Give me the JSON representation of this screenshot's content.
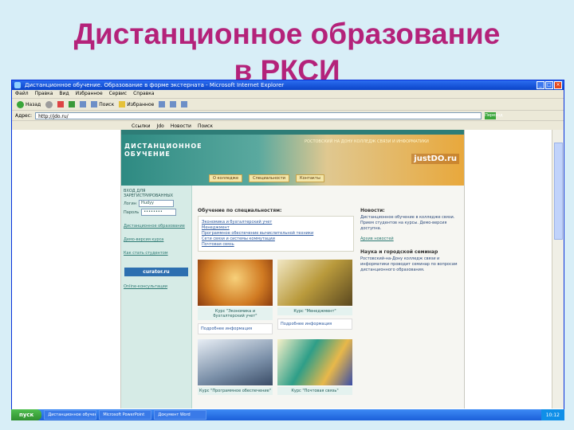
{
  "slide": {
    "title_line1": "Дистанционное образование",
    "title_line2": "в РКСИ"
  },
  "browser": {
    "window_title": "Дистанционное обучение. Образование в форме экстерната - Microsoft Internet Explorer",
    "menu": [
      "Файл",
      "Правка",
      "Вид",
      "Избранное",
      "Сервис",
      "Справка"
    ],
    "toolbar": {
      "back": "Назад",
      "search": "Поиск",
      "favorites": "Избранное"
    },
    "address_label": "Адрес:",
    "address_value": "http://jdo.ru/",
    "go_label": "Переход",
    "links": [
      "Ссылки",
      "Jdo",
      "Новости",
      "Поиск"
    ]
  },
  "site": {
    "logo": "ДИСТАНЦИОННОЕ ОБУЧЕНИЕ",
    "tagline": "РОСТОВСКИЙ НА ДОНУ КОЛЛЕДЖ СВЯЗИ И ИНФОРМАТИКИ",
    "brand": "justDO.ru",
    "nav": [
      "О колледже",
      "Специальности",
      "Контакты"
    ],
    "login": {
      "label": "ВХОД ДЛЯ ЗАРЕГИСТРИРОВАННЫХ",
      "login_label": "Логин",
      "login_value": "Hudyy",
      "password_label": "Пароль",
      "password_value": "••••••••"
    },
    "side_links": [
      "Дистанционное образование",
      "Демо-версия курса",
      "Как стать студентом"
    ],
    "badge": "curator.ru",
    "side_bottom": "Online-консультации",
    "section_title": "Обучение по специальностям:",
    "specialties": [
      "Экономика и бухгалтерский учет",
      "Менеджмент",
      "Программное обеспечение вычислительной техники",
      "Сети связи и системы коммутации",
      "Почтовая связь"
    ],
    "captions": [
      "Курс \"Экономика и бухгалтерский учет\"",
      "Курс \"Менеджмент\""
    ],
    "blocks": [
      "Подробнее информация",
      "Подробнее информация"
    ],
    "captions2": [
      "Курс \"Программное обеспечение\"",
      "Курс \"Почтовая связь\""
    ],
    "news_head": "Новости:",
    "news_text": "Дистанционное обучение в колледже связи. Прием студентов на курсы. Демо-версия доступна.",
    "news_link": "Архив новостей",
    "news_head2": "Наука и городской семинар",
    "news_text2": "Ростовский-на-Дону колледж связи и информатики проводит семинар по вопросам дистанционного образования."
  },
  "taskbar": {
    "start": "пуск",
    "items": [
      "Дистанционное обучение",
      "Microsoft PowerPoint",
      "Документ Word"
    ],
    "clock": "10:12"
  }
}
